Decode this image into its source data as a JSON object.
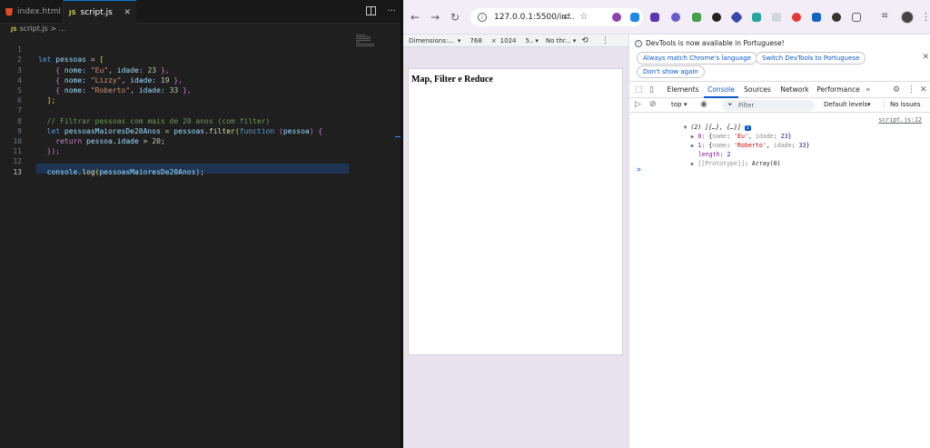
{
  "editor": {
    "tabs": [
      {
        "label": "index.html"
      },
      {
        "label": "script.js"
      }
    ],
    "breadcrumb": {
      "file": "script.js",
      "sep": ">",
      "more": "..."
    },
    "code_lines": [
      {
        "n": "1"
      },
      {
        "n": "2"
      },
      {
        "n": "3"
      },
      {
        "n": "4"
      },
      {
        "n": "5"
      },
      {
        "n": "6"
      },
      {
        "n": "7"
      },
      {
        "n": "8"
      },
      {
        "n": "9"
      },
      {
        "n": "10"
      },
      {
        "n": "11"
      },
      {
        "n": "12"
      },
      {
        "n": "13"
      }
    ],
    "code": {
      "l1": {
        "kw": "let",
        "name": "pessoas",
        "eq": "=",
        "br": "["
      },
      "l2": {
        "open": "{",
        "k1": "nome:",
        "v1": "\"Eu\"",
        "k2": "idade:",
        "v2": "23",
        "close": "},"
      },
      "l3": {
        "open": "{",
        "k1": "nome:",
        "v1": "\"Lizzy\"",
        "k2": "idade:",
        "v2": "19",
        "close": "},"
      },
      "l4": {
        "open": "{",
        "k1": "nome:",
        "v1": "\"Roberto\"",
        "k2": "idade:",
        "v2": "33",
        "close": "},"
      },
      "l5": {
        "close": "];"
      },
      "l7": {
        "comment": "// Filtrar pessoas com mais de 20 anos (com filter)"
      },
      "l8": {
        "kw": "let",
        "name": "pessoasMaioresDe20Anos",
        "eq": "=",
        "obj": "pessoas",
        "fn": "filter",
        "kwfn": "function",
        "param": "pessoa",
        "open": "{"
      },
      "l9": {
        "kw": "return",
        "expr": "pessoa",
        "prop": "idade",
        "op": ">",
        "num": "20",
        "semi": ";"
      },
      "l10": {
        "close": "});"
      },
      "l12": {
        "obj": "console",
        "fn": "log",
        "arg": "pessoasMaioresDe20Anos",
        "end": ");"
      }
    }
  },
  "browser": {
    "url": "127.0.0.1:5500/in...",
    "device_bar": {
      "dimensions": "Dimensions:...",
      "width": "768",
      "x": "×",
      "height": "1024",
      "zoom": "5..",
      "throttle": "No thr..."
    },
    "page": {
      "title": "Map, Filter e Reduce"
    }
  },
  "devtools": {
    "info": {
      "message": "DevTools is now available in Portuguese!",
      "btn_match": "Always match Chrome's language",
      "btn_switch": "Switch DevTools to Portuguese",
      "btn_dont": "Don't show again"
    },
    "tabs": [
      "Elements",
      "Console",
      "Sources",
      "Network",
      "Performance"
    ],
    "active_tab": "Console",
    "console_bar": {
      "context": "top",
      "filter_placeholder": "Filter",
      "levels": "Default levels",
      "issues": "No Issues"
    },
    "output": {
      "header": "(2) [{…}, {…}]",
      "badge": "i",
      "source": "script.js:12",
      "item0": {
        "idx": "0:",
        "nome_k": "nome",
        "nome_v": "'Eu'",
        "idade_k": "idade",
        "idade_v": "23"
      },
      "item1": {
        "idx": "1:",
        "nome_k": "nome",
        "nome_v": "'Roberto'",
        "idade_k": "idade",
        "idade_v": "33"
      },
      "length_k": "length",
      "length_v": "2",
      "proto_k": "[[Prototype]]",
      "proto_v": "Array(0)"
    },
    "prompt": ">"
  },
  "colors": {
    "accent": "#0b57d0",
    "vscode_bg": "#1f1f1f",
    "tab_active_border": "#0078d4"
  }
}
